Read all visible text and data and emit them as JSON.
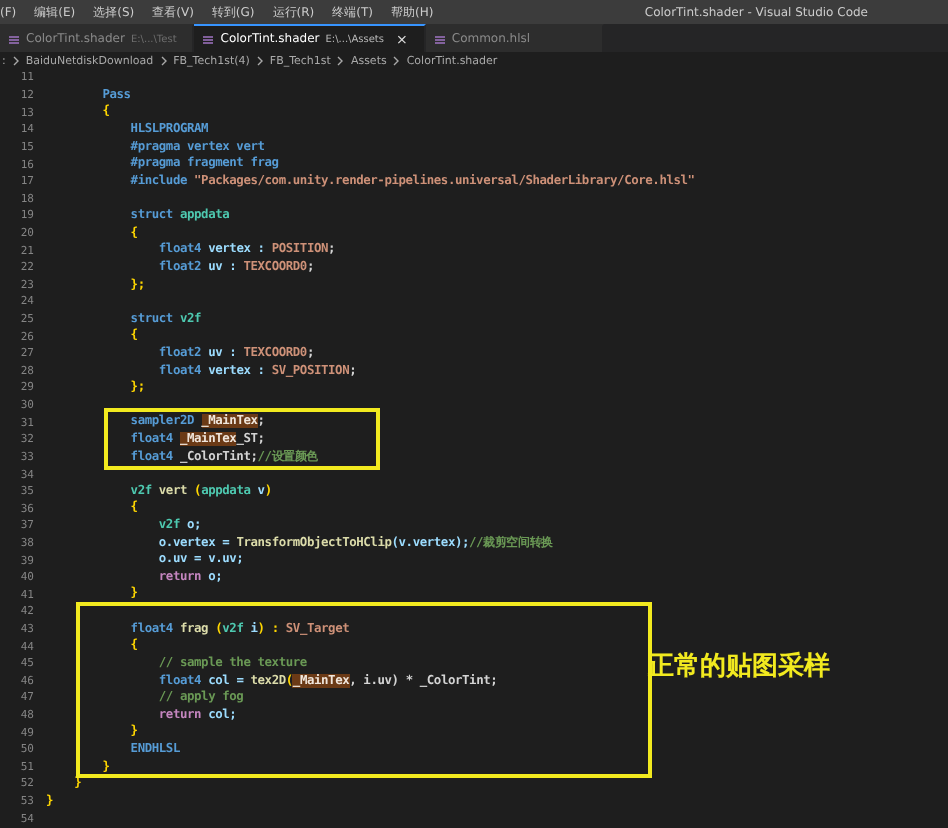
{
  "menu": [
    "(F)",
    "编辑(E)",
    "选择(S)",
    "查看(V)",
    "转到(G)",
    "运行(R)",
    "终端(T)",
    "帮助(H)"
  ],
  "window": {
    "title": "ColorTint.shader - Visual Studio Code"
  },
  "tabs": [
    {
      "label": "ColorTint.shader",
      "path": "E:\\...\\Test",
      "selected": false
    },
    {
      "label": "ColorTint.shader",
      "path": "E:\\...\\Assets",
      "selected": true,
      "close": "×"
    },
    {
      "label": "Common.hlsl",
      "selected": false
    }
  ],
  "breadcrumb": [
    ":",
    "BaiduNetdiskDownload",
    "FB_Tech1st(4)",
    "FB_Tech1st",
    "Assets",
    "ColorTint.shader"
  ],
  "code": [
    {
      "kind": "plain",
      "lines": [
        {
          "n": "11"
        },
        {
          "n": "12",
          "t": [
            {
              "s": "        Pass",
              "color": "#569cd6"
            }
          ]
        },
        {
          "n": "13",
          "t": [
            {
              "s": "        {",
              "color": "#ffd700"
            }
          ]
        },
        {
          "n": "14",
          "t": [
            {
              "s": "            HLSLPROGRAM",
              "color": "#569cd6"
            }
          ]
        },
        {
          "n": "15",
          "t": [
            {
              "s": "            #pragma vertex vert",
              "color": "#569cd6"
            }
          ]
        },
        {
          "n": "16",
          "t": [
            {
              "s": "            #pragma fragment frag",
              "color": "#569cd6"
            }
          ]
        },
        {
          "n": "17",
          "t": [
            {
              "s": "            #include ",
              "color": "#569cd6"
            },
            {
              "s": "\"Packages/com.unity.render-pipelines.universal/ShaderLibrary/Core.hlsl\"",
              "color": "#ce9178"
            }
          ]
        },
        {
          "n": "18"
        },
        {
          "n": "19",
          "t": [
            {
              "s": "            struct ",
              "color": "#569cd6"
            },
            {
              "s": "appdata",
              "color": "#4ec9b0"
            }
          ]
        },
        {
          "n": "20",
          "t": [
            {
              "s": "            {",
              "color": "#ffd700"
            }
          ]
        },
        {
          "n": "21",
          "t": [
            {
              "s": "                float4 ",
              "color": "#569cd6"
            },
            {
              "s": "vertex : ",
              "color": "#9cdcfe"
            },
            {
              "s": "POSITION",
              "color": "#ce9178"
            },
            {
              "s": ";",
              "color": "#d4d4d4"
            }
          ]
        },
        {
          "n": "22",
          "t": [
            {
              "s": "                float2 ",
              "color": "#569cd6"
            },
            {
              "s": "uv : ",
              "color": "#9cdcfe"
            },
            {
              "s": "TEXCOORD0",
              "color": "#ce9178"
            },
            {
              "s": ";",
              "color": "#d4d4d4"
            }
          ]
        },
        {
          "n": "23",
          "t": [
            {
              "s": "            };",
              "color": "#ffd700"
            }
          ]
        },
        {
          "n": "24"
        },
        {
          "n": "25",
          "t": [
            {
              "s": "            struct ",
              "color": "#569cd6"
            },
            {
              "s": "v2f",
              "color": "#4ec9b0"
            }
          ]
        },
        {
          "n": "26",
          "t": [
            {
              "s": "            {",
              "color": "#ffd700"
            }
          ]
        },
        {
          "n": "27",
          "t": [
            {
              "s": "                float2 ",
              "color": "#569cd6"
            },
            {
              "s": "uv : ",
              "color": "#9cdcfe"
            },
            {
              "s": "TEXCOORD0",
              "color": "#ce9178"
            },
            {
              "s": ";",
              "color": "#d4d4d4"
            }
          ]
        },
        {
          "n": "28",
          "t": [
            {
              "s": "                float4 ",
              "color": "#569cd6"
            },
            {
              "s": "vertex : ",
              "color": "#9cdcfe"
            },
            {
              "s": "SV_POSITION",
              "color": "#ce9178"
            },
            {
              "s": ";",
              "color": "#d4d4d4"
            }
          ]
        },
        {
          "n": "29",
          "t": [
            {
              "s": "            };",
              "color": "#ffd700"
            }
          ]
        },
        {
          "n": "30"
        }
      ]
    },
    {
      "kind": "box",
      "lines": [
        {
          "n": "31",
          "t": [
            {
              "s": "            sampler2D ",
              "color": "#569cd6"
            },
            {
              "s": "_MainTex",
              "highlighted": true
            },
            {
              "s": ";",
              "color": "#d4d4d4"
            }
          ]
        },
        {
          "n": "32",
          "t": [
            {
              "s": "            float4 ",
              "color": "#569cd6"
            },
            {
              "s": "_MainTex",
              "highlighted": true
            },
            {
              "s": "_ST;",
              "color": "#d4d4d4"
            }
          ]
        },
        {
          "n": "33",
          "t": [
            {
              "s": "            float4 ",
              "color": "#569cd6"
            },
            {
              "s": "_ColorTint;",
              "color": "#d4d4d4"
            },
            {
              "s": "//设置颜色",
              "color": "#6a9955"
            }
          ]
        }
      ]
    },
    {
      "kind": "plain",
      "lines": [
        {
          "n": "34"
        },
        {
          "n": "35",
          "t": [
            {
              "s": "            v2f ",
              "color": "#4ec9b0"
            },
            {
              "s": "vert ",
              "color": "#dcdcaa"
            },
            {
              "s": "(",
              "color": "#ffd700"
            },
            {
              "s": "appdata ",
              "color": "#4ec9b0"
            },
            {
              "s": "v",
              "color": "#9cdcfe"
            },
            {
              "s": ")",
              "color": "#ffd700"
            }
          ]
        },
        {
          "n": "36",
          "t": [
            {
              "s": "            {",
              "color": "#ffd700"
            }
          ]
        },
        {
          "n": "37",
          "t": [
            {
              "s": "                v2f ",
              "color": "#4ec9b0"
            },
            {
              "s": "o;",
              "color": "#9cdcfe"
            }
          ]
        },
        {
          "n": "38",
          "t": [
            {
              "s": "                o.vertex = ",
              "color": "#9cdcfe"
            },
            {
              "s": "TransformObjectToHClip",
              "color": "#dcdcaa"
            },
            {
              "s": "(v.vertex);",
              "color": "#9cdcfe"
            },
            {
              "s": "//裁剪空间转换",
              "color": "#6a9955"
            }
          ]
        },
        {
          "n": "39",
          "t": [
            {
              "s": "                o.uv = v.uv;",
              "color": "#9cdcfe"
            }
          ]
        },
        {
          "n": "40",
          "t": [
            {
              "s": "                return ",
              "color": "#c586c0"
            },
            {
              "s": "o;",
              "color": "#9cdcfe"
            }
          ]
        },
        {
          "n": "41",
          "t": [
            {
              "s": "            }",
              "color": "#ffd700"
            }
          ]
        }
      ]
    },
    {
      "kind": "box",
      "label": "正常的贴图采样",
      "lines": [
        {
          "n": "42"
        },
        {
          "n": "43",
          "t": [
            {
              "s": "            float4 ",
              "color": "#569cd6"
            },
            {
              "s": "frag ",
              "color": "#dcdcaa"
            },
            {
              "s": "(",
              "color": "#ffd700"
            },
            {
              "s": "v2f ",
              "color": "#4ec9b0"
            },
            {
              "s": "i",
              "color": "#9cdcfe"
            },
            {
              "s": ") : ",
              "color": "#ffd700"
            },
            {
              "s": "SV_Target",
              "color": "#ce9178"
            }
          ]
        },
        {
          "n": "44",
          "t": [
            {
              "s": "            {",
              "color": "#ffd700"
            }
          ]
        },
        {
          "n": "45",
          "t": [
            {
              "s": "                // sample the texture",
              "color": "#6a9955"
            }
          ]
        },
        {
          "n": "46",
          "t": [
            {
              "s": "                float4 ",
              "color": "#569cd6"
            },
            {
              "s": "col = ",
              "color": "#9cdcfe"
            },
            {
              "s": "tex2D",
              "color": "#dcdcaa"
            },
            {
              "s": "(",
              "color": "#ffd700"
            },
            {
              "s": "_MainTex",
              "highlighted": true
            },
            {
              "s": ", i.uv) * _ColorTint;",
              "color": "#d4d4d4"
            }
          ]
        },
        {
          "n": "47",
          "t": [
            {
              "s": "                // apply fog",
              "color": "#6a9955"
            }
          ]
        },
        {
          "n": "48",
          "t": [
            {
              "s": "                return ",
              "color": "#c586c0"
            },
            {
              "s": "col;",
              "color": "#9cdcfe"
            }
          ]
        },
        {
          "n": "49",
          "t": [
            {
              "s": "            }",
              "color": "#ffd700"
            }
          ]
        },
        {
          "n": "50",
          "t": [
            {
              "s": "            ENDHLSL",
              "color": "#569cd6"
            }
          ]
        },
        {
          "n": "51",
          "t": [
            {
              "s": "        }",
              "color": "#ffd700"
            }
          ]
        }
      ]
    },
    {
      "kind": "plain",
      "lines": [
        {
          "n": "52",
          "t": [
            {
              "s": "    }",
              "color": "#ffd700"
            }
          ]
        },
        {
          "n": "53",
          "t": [
            {
              "s": "}",
              "color": "#ffd700"
            }
          ]
        },
        {
          "n": "54"
        }
      ]
    }
  ]
}
